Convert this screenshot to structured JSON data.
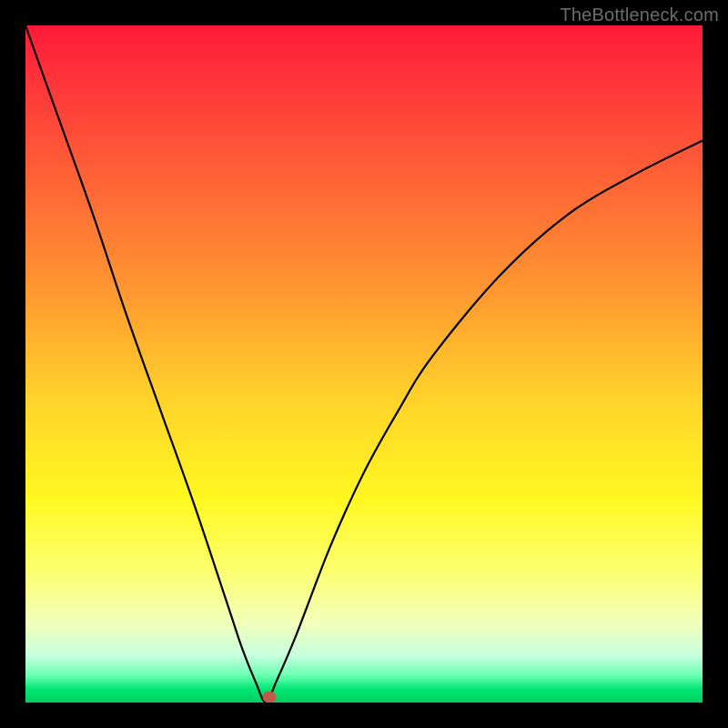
{
  "watermark": "TheBottleneck.com",
  "chart_data": {
    "type": "line",
    "title": "",
    "xlabel": "",
    "ylabel": "",
    "xlim": [
      0,
      100
    ],
    "ylim": [
      0,
      100
    ],
    "grid": false,
    "legend": null,
    "series": [
      {
        "name": "curve",
        "x": [
          0,
          5,
          10,
          15,
          20,
          25,
          30,
          32,
          34,
          35.5,
          37,
          40,
          45,
          50,
          55,
          60,
          70,
          80,
          90,
          100
        ],
        "values": [
          100,
          86,
          72,
          57,
          43,
          29,
          14,
          8,
          3,
          0,
          3,
          10,
          23,
          34,
          43,
          51,
          63,
          72,
          78,
          83
        ]
      }
    ],
    "marker": {
      "x": 36,
      "y": 0.8
    },
    "colors": {
      "curve": "#000000",
      "marker": "#bf5a4a",
      "gradient_top": "#ff1a3a",
      "gradient_bottom": "#00d060"
    }
  }
}
